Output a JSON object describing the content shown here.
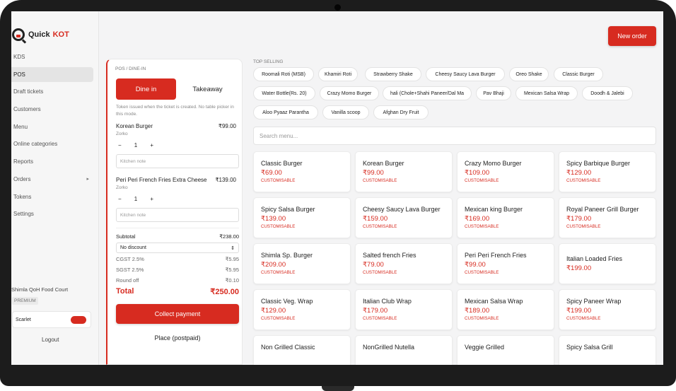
{
  "brand": {
    "name": "Quick",
    "accent": "KOT",
    "accent_color": "#d72b20"
  },
  "nav": [
    {
      "label": "KDS",
      "active": false,
      "caret": false
    },
    {
      "label": "POS",
      "active": true,
      "caret": false
    },
    {
      "label": "Draft tickets",
      "active": false,
      "caret": false
    },
    {
      "label": "Customers",
      "active": false,
      "caret": false
    },
    {
      "label": "Menu",
      "active": false,
      "caret": false
    },
    {
      "label": "Online categories",
      "active": false,
      "caret": false
    },
    {
      "label": "Reports",
      "active": false,
      "caret": false
    },
    {
      "label": "Orders",
      "active": false,
      "caret": true
    },
    {
      "label": "Tokens",
      "active": false,
      "caret": false
    },
    {
      "label": "Settings",
      "active": false,
      "caret": false
    }
  ],
  "account": {
    "venue": "Shimla QoH Food Court",
    "plan": "PREMIUM",
    "user": "Scarlet",
    "logout": "Logout"
  },
  "header": {
    "new_order": "New order"
  },
  "ticket": {
    "label": "POS / DINE-IN",
    "mode_dine": "Dine in",
    "mode_take": "Takeaway",
    "hint": "Token issued when the ticket is created. No table picker in this mode.",
    "items": [
      {
        "name": "Korean Burger",
        "sub": "Zorko",
        "price": "₹99.00",
        "qty": "1",
        "note_placeholder": "Kitchen note"
      },
      {
        "name": "Peri Peri French Fries Extra Cheese",
        "sub": "Zorko",
        "price": "₹139.00",
        "qty": "1",
        "note_placeholder": "Kitchen note"
      }
    ],
    "minus": "−",
    "plus": "+",
    "subtotal_label": "Subtotal",
    "subtotal": "₹238.00",
    "discount": "No discount",
    "cgst_label": "CGST 2.5%",
    "cgst": "₹5.95",
    "sgst_label": "SGST 2.5%",
    "sgst": "₹5.95",
    "roundoff_label": "Round off",
    "roundoff": "₹0.10",
    "total_label": "Total",
    "total": "₹250.00",
    "collect": "Collect payment",
    "place": "Place (postpaid)"
  },
  "top_selling": {
    "label": "TOP SELLING",
    "chips": [
      "Roomali Roti (MSB)",
      "Khamiri Roti",
      "Strawberry Shake",
      "Cheesy Saucy Lava Burger",
      "Oreo Shake",
      "Classic Burger",
      "Water Bottle(Rs. 20)",
      "Crazy Momo Burger",
      "hali (Chole+Shahi Paneer/Dal Ma",
      "Pav Bhaji",
      "Mexican Salsa Wrap",
      "Doodh & Jalebi",
      "Aloo Pyaaz Parantha",
      "Vanilla scoop",
      "Afghan Dry Fruit"
    ]
  },
  "search": {
    "placeholder": "Search menu..."
  },
  "menu": [
    {
      "name": "Classic Burger",
      "price": "₹69.00",
      "tag": "CUSTOMISABLE"
    },
    {
      "name": "Korean Burger",
      "price": "₹99.00",
      "tag": "CUSTOMISABLE"
    },
    {
      "name": "Crazy Momo Burger",
      "price": "₹109.00",
      "tag": "CUSTOMISABLE"
    },
    {
      "name": "Spicy Barbique Burger",
      "price": "₹129.00",
      "tag": "CUSTOMISABLE"
    },
    {
      "name": "Spicy Salsa Burger",
      "price": "₹139.00",
      "tag": "CUSTOMISABLE"
    },
    {
      "name": "Cheesy Saucy Lava Burger",
      "price": "₹159.00",
      "tag": "CUSTOMISABLE"
    },
    {
      "name": "Mexican king Burger",
      "price": "₹169.00",
      "tag": "CUSTOMISABLE"
    },
    {
      "name": "Royal Paneer Grill Burger",
      "price": "₹179.00",
      "tag": "CUSTOMISABLE"
    },
    {
      "name": "Shimla Sp. Burger",
      "price": "₹209.00",
      "tag": "CUSTOMISABLE"
    },
    {
      "name": "Salted french Fries",
      "price": "₹79.00",
      "tag": "CUSTOMISABLE"
    },
    {
      "name": "Peri Peri French Fries",
      "price": "₹99.00",
      "tag": "CUSTOMISABLE"
    },
    {
      "name": "Italian Loaded Fries",
      "price": "₹199.00",
      "tag": ""
    },
    {
      "name": "Classic Veg. Wrap",
      "price": "₹129.00",
      "tag": "CUSTOMISABLE"
    },
    {
      "name": "Italian Club Wrap",
      "price": "₹179.00",
      "tag": "CUSTOMISABLE"
    },
    {
      "name": "Mexican Salsa Wrap",
      "price": "₹189.00",
      "tag": "CUSTOMISABLE"
    },
    {
      "name": "Spicy Paneer Wrap",
      "price": "₹199.00",
      "tag": "CUSTOMISABLE"
    },
    {
      "name": "Non Grilled Classic",
      "price": "",
      "tag": ""
    },
    {
      "name": "NonGrilled Nutella",
      "price": "",
      "tag": ""
    },
    {
      "name": "Veggie Grilled",
      "price": "",
      "tag": ""
    },
    {
      "name": "Spicy Salsa Grill",
      "price": "",
      "tag": ""
    }
  ]
}
